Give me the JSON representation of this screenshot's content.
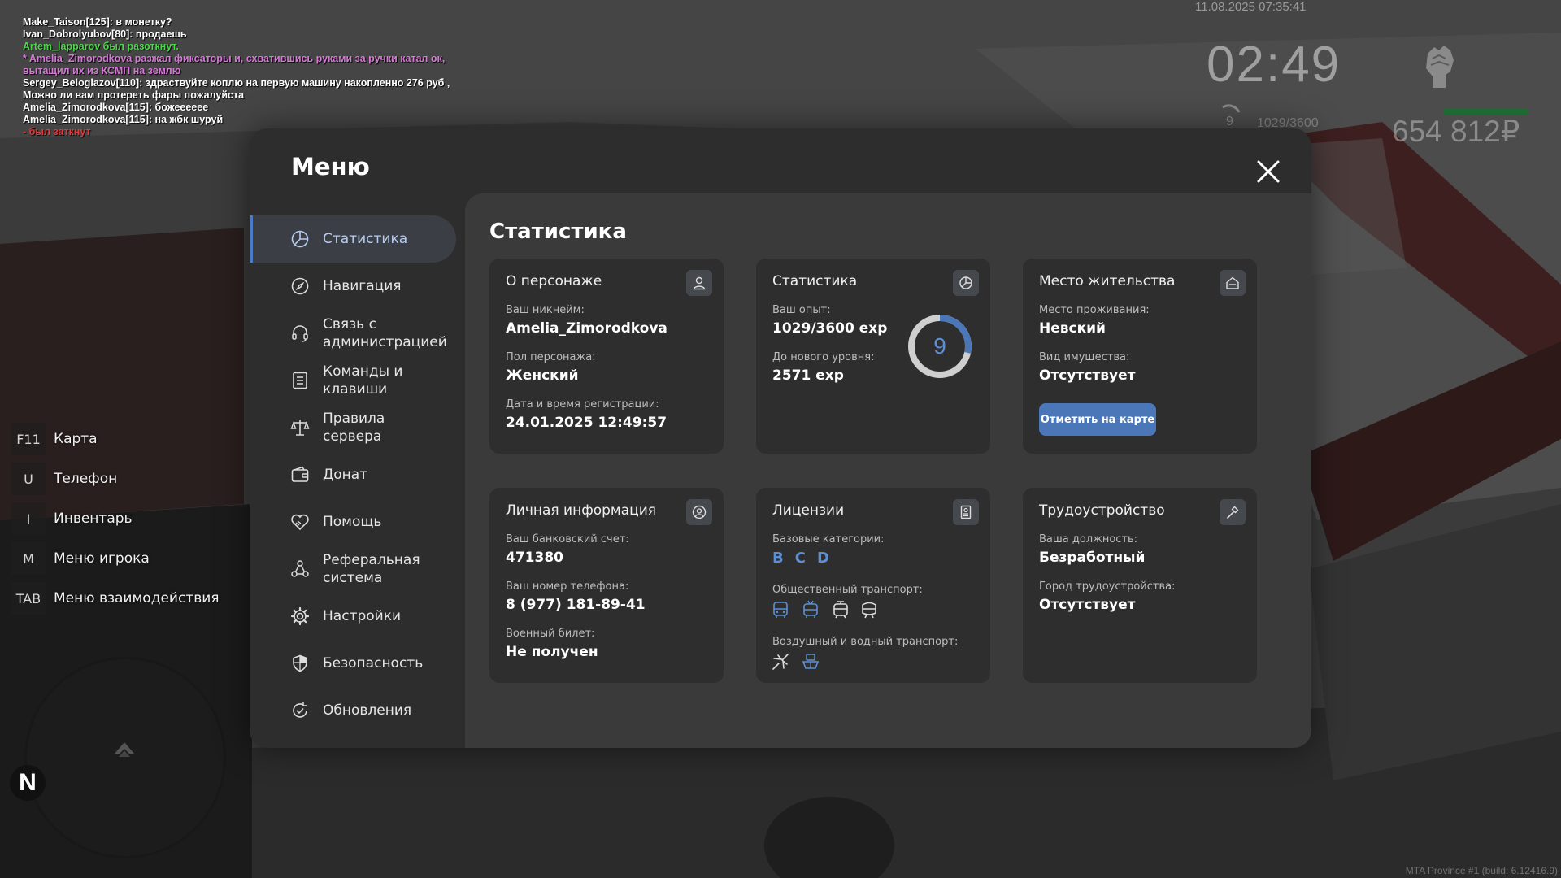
{
  "chat": [
    {
      "text": "Make_Taison[125]: в монетку?",
      "color": "#ffffff"
    },
    {
      "text": "Ivan_Dobrolyubov[80]: продаешь",
      "color": "#ffffff"
    },
    {
      "text": "Artem_lapparov был разоткнут.",
      "color": "#4cd64c"
    },
    {
      "text": "* Amelia_Zimorodkova разжал фиксаторы и, схватившись руками за ручки катал ок, вытащил их из КСМП на землю",
      "color": "#d57ad5"
    },
    {
      "text": "Sergey_Beloglazov[110]: здраствуйте коплю на первую машину накопленно 276 руб , Можно ли вам протереть фары пожалуйста",
      "color": "#ffffff"
    },
    {
      "text": "Amelia_Zimorodkova[115]: божееееее",
      "color": "#ffffff"
    },
    {
      "text": "Amelia_Zimorodkova[115]: на жбк шуруй",
      "color": "#ffffff"
    },
    {
      "text": "- был заткнут",
      "color": "#e23a3a"
    }
  ],
  "hud": {
    "datetime": "11.08.2025 07:35:41",
    "time": "02:49",
    "level": "9",
    "exp": "1029/3600",
    "money": "654 812₽",
    "hp_fraction": 1.0
  },
  "hotkeys": [
    {
      "key": "F11",
      "label": "Карта"
    },
    {
      "key": "U",
      "label": "Телефон"
    },
    {
      "key": "I",
      "label": "Инвентарь"
    },
    {
      "key": "M",
      "label": "Меню игрока"
    },
    {
      "key": "TAB",
      "label": "Меню взаимодействия"
    }
  ],
  "minimap": {
    "north": "N"
  },
  "build": "MTA Province #1 (build: 6.12416.9)",
  "menu": {
    "title": "Меню",
    "nav": [
      {
        "label": "Статистика",
        "icon": "chart-pie-icon",
        "active": true
      },
      {
        "label": "Навигация",
        "icon": "compass-icon"
      },
      {
        "label": "Связь с администрацией",
        "icon": "headset-icon"
      },
      {
        "label": "Команды и клавиши",
        "icon": "document-list-icon"
      },
      {
        "label": "Правила сервера",
        "icon": "scales-icon"
      },
      {
        "label": "Донат",
        "icon": "wallet-icon"
      },
      {
        "label": "Помощь",
        "icon": "handshake-heart-icon"
      },
      {
        "label": "Реферальная система",
        "icon": "users-network-icon"
      },
      {
        "label": "Настройки",
        "icon": "gear-icon"
      },
      {
        "label": "Безопасность",
        "icon": "shield-icon"
      },
      {
        "label": "Обновления",
        "icon": "refresh-check-icon"
      }
    ],
    "content_title": "Статистика",
    "cards": {
      "character": {
        "title": "О персонаже",
        "nickname_label": "Ваш никнейм:",
        "nickname": "Amelia_Zimorodkova",
        "gender_label": "Пол персонажа:",
        "gender": "Женский",
        "reg_label": "Дата и время регистрации:",
        "reg": "24.01.2025 12:49:57"
      },
      "stats": {
        "title": "Статистика",
        "exp_label": "Ваш опыт:",
        "exp": "1029/3600 exp",
        "next_label": "До нового уровня:",
        "next": "2571 exp",
        "level": "9",
        "progress": 0.286
      },
      "residence": {
        "title": "Место жительства",
        "place_label": "Место проживания:",
        "place": "Невский",
        "property_label": "Вид имущества:",
        "property": "Отсутствует",
        "button": "Отметить на карте"
      },
      "personal": {
        "title": "Личная информация",
        "bank_label": "Ваш банковский счет:",
        "bank": "471380",
        "phone_label": "Ваш номер телефона:",
        "phone": "8 (977) 181-89-41",
        "military_label": "Военный билет:",
        "military": "Не получен"
      },
      "licenses": {
        "title": "Лицензии",
        "base_label": "Базовые категории:",
        "categories": [
          "B",
          "C",
          "D"
        ],
        "public_label": "Общественный транспорт:",
        "air_label": "Воздушный и водный транспорт:"
      },
      "employment": {
        "title": "Трудоустройство",
        "position_label": "Ваша должность:",
        "position": "Безработный",
        "city_label": "Город трудоустройства:",
        "city": "Отсутствует"
      }
    }
  }
}
